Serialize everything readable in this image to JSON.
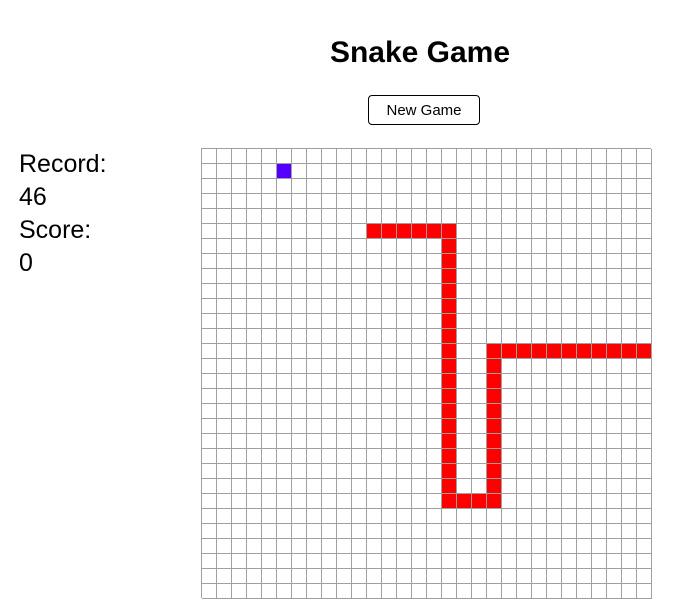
{
  "header": {
    "title": "Snake Game",
    "new_game_label": "New Game"
  },
  "stats": {
    "record_label": "Record:",
    "record_value": "46",
    "score_label": "Score:",
    "score_value": "0"
  },
  "board": {
    "cols": 30,
    "rows": 30,
    "grid_color": "#a0a0a0",
    "snake_color": "#ff0000",
    "food_color": "#5500ff",
    "food": [
      5,
      1
    ],
    "snake": [
      [
        11,
        5
      ],
      [
        12,
        5
      ],
      [
        13,
        5
      ],
      [
        14,
        5
      ],
      [
        15,
        5
      ],
      [
        16,
        5
      ],
      [
        16,
        6
      ],
      [
        16,
        7
      ],
      [
        16,
        8
      ],
      [
        16,
        9
      ],
      [
        16,
        10
      ],
      [
        16,
        11
      ],
      [
        16,
        12
      ],
      [
        16,
        13
      ],
      [
        16,
        14
      ],
      [
        16,
        15
      ],
      [
        16,
        16
      ],
      [
        16,
        17
      ],
      [
        16,
        18
      ],
      [
        16,
        19
      ],
      [
        16,
        20
      ],
      [
        16,
        21
      ],
      [
        16,
        22
      ],
      [
        16,
        23
      ],
      [
        17,
        23
      ],
      [
        18,
        23
      ],
      [
        19,
        23
      ],
      [
        19,
        22
      ],
      [
        19,
        21
      ],
      [
        19,
        20
      ],
      [
        19,
        19
      ],
      [
        19,
        18
      ],
      [
        19,
        17
      ],
      [
        19,
        16
      ],
      [
        19,
        15
      ],
      [
        19,
        14
      ],
      [
        19,
        13
      ],
      [
        20,
        13
      ],
      [
        21,
        13
      ],
      [
        22,
        13
      ],
      [
        23,
        13
      ],
      [
        24,
        13
      ],
      [
        25,
        13
      ],
      [
        26,
        13
      ],
      [
        27,
        13
      ],
      [
        28,
        13
      ],
      [
        29,
        13
      ]
    ]
  }
}
